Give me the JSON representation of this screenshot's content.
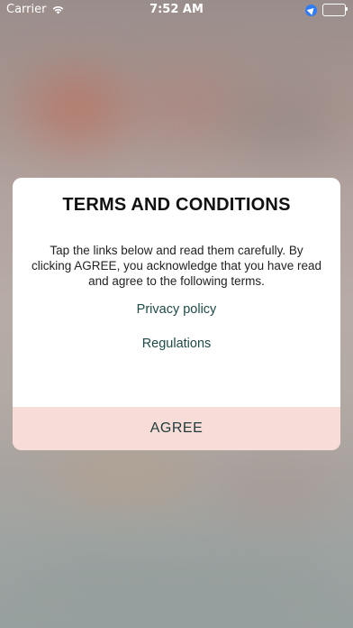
{
  "status_bar": {
    "carrier": "Carrier",
    "time": "7:52 AM",
    "icons": [
      "wifi-icon",
      "location-icon",
      "battery-icon"
    ],
    "battery_level": 1.0
  },
  "dialog": {
    "title": "TERMS AND CONDITIONS",
    "body": "Tap the links below and read them carefully. By clicking AGREE, you acknowledge that you have read and agree to the following terms.",
    "links": [
      {
        "label": "Privacy policy"
      },
      {
        "label": "Regulations"
      }
    ],
    "agree_label": "AGREE"
  },
  "colors": {
    "agree_background": "#f8dcd8",
    "link_text": "#1e4a48",
    "dialog_background": "#ffffff",
    "location_icon": "#2f7cf6"
  }
}
